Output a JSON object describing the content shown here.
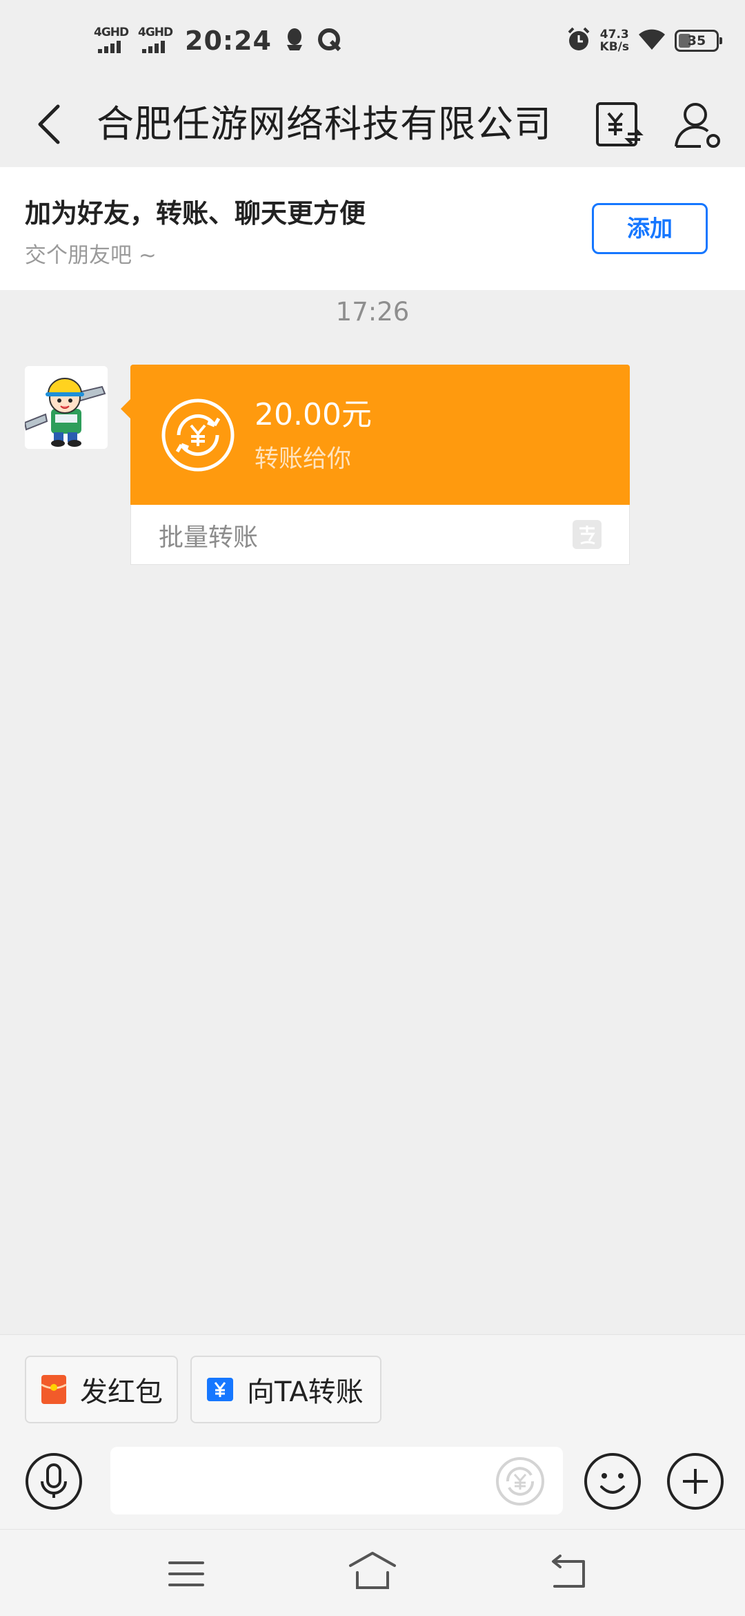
{
  "status_bar": {
    "signal1_label": "4GHD",
    "signal2_label": "4GHD",
    "time": "20:24",
    "speed_value": "47.3",
    "speed_unit": "KB/s",
    "battery": "35",
    "icons": [
      "qq-icon",
      "ball-icon",
      "alarm-icon",
      "wifi-icon",
      "battery-icon"
    ]
  },
  "header": {
    "title": "合肥任游网络科技有限公司",
    "icons": [
      "back-arrow-icon",
      "transfer-icon",
      "profile-settings-icon"
    ]
  },
  "banner": {
    "title": "加为好友，转账、聊天更方便",
    "subtitle": "交个朋友吧 ~",
    "add_label": "添加"
  },
  "chat": {
    "timestamp": "17:26",
    "message": {
      "amount": "20.00元",
      "description": "转账给你",
      "footer_label": "批量转账",
      "icons": [
        "avatar-cartoon-worker",
        "transfer-coin-icon",
        "alipay-icon"
      ]
    }
  },
  "composer": {
    "red_packet_label": "发红包",
    "transfer_label": "向TA转账",
    "input_placeholder": "",
    "icons": [
      "red-packet-icon",
      "yuan-card-icon",
      "microphone-icon",
      "transfer-coin-icon",
      "emoji-icon",
      "plus-icon"
    ]
  },
  "navbar": {
    "icons": [
      "menu-icon",
      "home-icon",
      "back-icon"
    ]
  },
  "colors": {
    "background": "#EFEFEF",
    "accent_blue": "#1677FF",
    "bubble_orange": "#FF9A0E",
    "red_packet": "#F25B2A"
  }
}
